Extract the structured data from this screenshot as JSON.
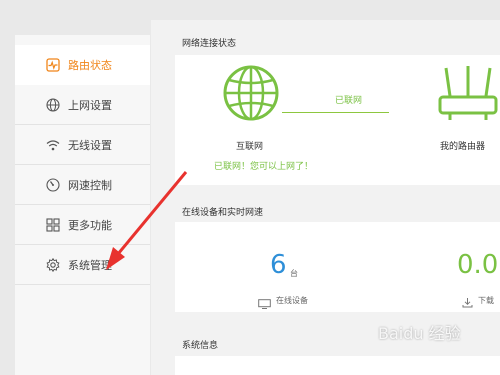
{
  "sidebar": {
    "items": [
      {
        "label": "路由状态",
        "icon": "pulse-icon",
        "active": true
      },
      {
        "label": "上网设置",
        "icon": "globe-icon",
        "active": false
      },
      {
        "label": "无线设置",
        "icon": "wifi-icon",
        "active": false
      },
      {
        "label": "网速控制",
        "icon": "speedometer-icon",
        "active": false
      },
      {
        "label": "更多功能",
        "icon": "grid-icon",
        "active": false
      },
      {
        "label": "系统管理",
        "icon": "gear-icon",
        "active": false
      }
    ]
  },
  "network": {
    "title": "网络连接状态",
    "internet_label": "互联网",
    "link_status": "已联网",
    "router_label": "我的路由器",
    "message": "已联网！您可以上网了！"
  },
  "devices": {
    "title": "在线设备和实时网速",
    "online_count": "6",
    "online_unit": "台",
    "online_label": "在线设备",
    "download_value": "0.0",
    "download_label": "下载"
  },
  "system": {
    "title": "系统信息"
  },
  "colors": {
    "accent_orange": "#f08519",
    "status_green": "#7ac143",
    "count_blue": "#2e8fd8",
    "arrow_red": "#e8322e"
  },
  "watermark": "Baidu 经验"
}
